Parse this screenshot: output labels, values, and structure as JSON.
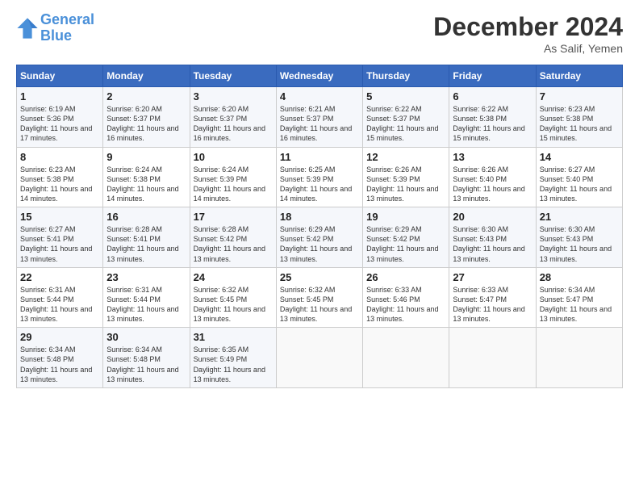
{
  "header": {
    "logo_line1": "General",
    "logo_line2": "Blue",
    "month": "December 2024",
    "location": "As Salif, Yemen"
  },
  "weekdays": [
    "Sunday",
    "Monday",
    "Tuesday",
    "Wednesday",
    "Thursday",
    "Friday",
    "Saturday"
  ],
  "weeks": [
    [
      {
        "day": "1",
        "sunrise": "Sunrise: 6:19 AM",
        "sunset": "Sunset: 5:36 PM",
        "daylight": "Daylight: 11 hours and 17 minutes."
      },
      {
        "day": "2",
        "sunrise": "Sunrise: 6:20 AM",
        "sunset": "Sunset: 5:37 PM",
        "daylight": "Daylight: 11 hours and 16 minutes."
      },
      {
        "day": "3",
        "sunrise": "Sunrise: 6:20 AM",
        "sunset": "Sunset: 5:37 PM",
        "daylight": "Daylight: 11 hours and 16 minutes."
      },
      {
        "day": "4",
        "sunrise": "Sunrise: 6:21 AM",
        "sunset": "Sunset: 5:37 PM",
        "daylight": "Daylight: 11 hours and 16 minutes."
      },
      {
        "day": "5",
        "sunrise": "Sunrise: 6:22 AM",
        "sunset": "Sunset: 5:37 PM",
        "daylight": "Daylight: 11 hours and 15 minutes."
      },
      {
        "day": "6",
        "sunrise": "Sunrise: 6:22 AM",
        "sunset": "Sunset: 5:38 PM",
        "daylight": "Daylight: 11 hours and 15 minutes."
      },
      {
        "day": "7",
        "sunrise": "Sunrise: 6:23 AM",
        "sunset": "Sunset: 5:38 PM",
        "daylight": "Daylight: 11 hours and 15 minutes."
      }
    ],
    [
      {
        "day": "8",
        "sunrise": "Sunrise: 6:23 AM",
        "sunset": "Sunset: 5:38 PM",
        "daylight": "Daylight: 11 hours and 14 minutes."
      },
      {
        "day": "9",
        "sunrise": "Sunrise: 6:24 AM",
        "sunset": "Sunset: 5:38 PM",
        "daylight": "Daylight: 11 hours and 14 minutes."
      },
      {
        "day": "10",
        "sunrise": "Sunrise: 6:24 AM",
        "sunset": "Sunset: 5:39 PM",
        "daylight": "Daylight: 11 hours and 14 minutes."
      },
      {
        "day": "11",
        "sunrise": "Sunrise: 6:25 AM",
        "sunset": "Sunset: 5:39 PM",
        "daylight": "Daylight: 11 hours and 14 minutes."
      },
      {
        "day": "12",
        "sunrise": "Sunrise: 6:26 AM",
        "sunset": "Sunset: 5:39 PM",
        "daylight": "Daylight: 11 hours and 13 minutes."
      },
      {
        "day": "13",
        "sunrise": "Sunrise: 6:26 AM",
        "sunset": "Sunset: 5:40 PM",
        "daylight": "Daylight: 11 hours and 13 minutes."
      },
      {
        "day": "14",
        "sunrise": "Sunrise: 6:27 AM",
        "sunset": "Sunset: 5:40 PM",
        "daylight": "Daylight: 11 hours and 13 minutes."
      }
    ],
    [
      {
        "day": "15",
        "sunrise": "Sunrise: 6:27 AM",
        "sunset": "Sunset: 5:41 PM",
        "daylight": "Daylight: 11 hours and 13 minutes."
      },
      {
        "day": "16",
        "sunrise": "Sunrise: 6:28 AM",
        "sunset": "Sunset: 5:41 PM",
        "daylight": "Daylight: 11 hours and 13 minutes."
      },
      {
        "day": "17",
        "sunrise": "Sunrise: 6:28 AM",
        "sunset": "Sunset: 5:42 PM",
        "daylight": "Daylight: 11 hours and 13 minutes."
      },
      {
        "day": "18",
        "sunrise": "Sunrise: 6:29 AM",
        "sunset": "Sunset: 5:42 PM",
        "daylight": "Daylight: 11 hours and 13 minutes."
      },
      {
        "day": "19",
        "sunrise": "Sunrise: 6:29 AM",
        "sunset": "Sunset: 5:42 PM",
        "daylight": "Daylight: 11 hours and 13 minutes."
      },
      {
        "day": "20",
        "sunrise": "Sunrise: 6:30 AM",
        "sunset": "Sunset: 5:43 PM",
        "daylight": "Daylight: 11 hours and 13 minutes."
      },
      {
        "day": "21",
        "sunrise": "Sunrise: 6:30 AM",
        "sunset": "Sunset: 5:43 PM",
        "daylight": "Daylight: 11 hours and 13 minutes."
      }
    ],
    [
      {
        "day": "22",
        "sunrise": "Sunrise: 6:31 AM",
        "sunset": "Sunset: 5:44 PM",
        "daylight": "Daylight: 11 hours and 13 minutes."
      },
      {
        "day": "23",
        "sunrise": "Sunrise: 6:31 AM",
        "sunset": "Sunset: 5:44 PM",
        "daylight": "Daylight: 11 hours and 13 minutes."
      },
      {
        "day": "24",
        "sunrise": "Sunrise: 6:32 AM",
        "sunset": "Sunset: 5:45 PM",
        "daylight": "Daylight: 11 hours and 13 minutes."
      },
      {
        "day": "25",
        "sunrise": "Sunrise: 6:32 AM",
        "sunset": "Sunset: 5:45 PM",
        "daylight": "Daylight: 11 hours and 13 minutes."
      },
      {
        "day": "26",
        "sunrise": "Sunrise: 6:33 AM",
        "sunset": "Sunset: 5:46 PM",
        "daylight": "Daylight: 11 hours and 13 minutes."
      },
      {
        "day": "27",
        "sunrise": "Sunrise: 6:33 AM",
        "sunset": "Sunset: 5:47 PM",
        "daylight": "Daylight: 11 hours and 13 minutes."
      },
      {
        "day": "28",
        "sunrise": "Sunrise: 6:34 AM",
        "sunset": "Sunset: 5:47 PM",
        "daylight": "Daylight: 11 hours and 13 minutes."
      }
    ],
    [
      {
        "day": "29",
        "sunrise": "Sunrise: 6:34 AM",
        "sunset": "Sunset: 5:48 PM",
        "daylight": "Daylight: 11 hours and 13 minutes."
      },
      {
        "day": "30",
        "sunrise": "Sunrise: 6:34 AM",
        "sunset": "Sunset: 5:48 PM",
        "daylight": "Daylight: 11 hours and 13 minutes."
      },
      {
        "day": "31",
        "sunrise": "Sunrise: 6:35 AM",
        "sunset": "Sunset: 5:49 PM",
        "daylight": "Daylight: 11 hours and 13 minutes."
      },
      null,
      null,
      null,
      null
    ]
  ]
}
